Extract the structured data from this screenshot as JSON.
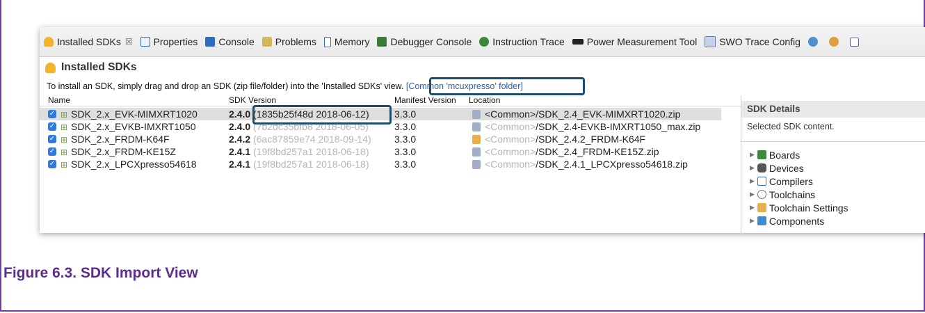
{
  "tabs": [
    {
      "label": "Installed SDKs",
      "icon": "sdk-icon",
      "cls": "sdk",
      "close": "☒"
    },
    {
      "label": "Properties",
      "icon": "properties-icon",
      "cls": "props"
    },
    {
      "label": "Console",
      "icon": "console-icon",
      "cls": "console"
    },
    {
      "label": "Problems",
      "icon": "problems-icon",
      "cls": "problems"
    },
    {
      "label": "Memory",
      "icon": "memory-icon",
      "cls": "memory"
    },
    {
      "label": "Debugger Console",
      "icon": "debugger-console-icon",
      "cls": "dbg"
    },
    {
      "label": "Instruction Trace",
      "icon": "instruction-trace-icon",
      "cls": "trace"
    },
    {
      "label": "Power Measurement Tool",
      "icon": "power-measurement-icon",
      "cls": "power"
    },
    {
      "label": "SWO Trace Config",
      "icon": "swo-trace-icon",
      "cls": "swo"
    }
  ],
  "view_title": "Installed SDKs",
  "instructions": {
    "text": "To install an SDK, simply drag and drop an SDK (zip file/folder) into the 'Installed SDKs' view.",
    "link": "[Common 'mcuxpresso' folder]"
  },
  "columns": {
    "name": "Name",
    "sdk_version": "SDK Version",
    "manifest_version": "Manifest Version",
    "location": "Location"
  },
  "rows": [
    {
      "name": "SDK_2.x_EVK-MIMXRT1020",
      "version": "2.4.0",
      "hash": "(1835b25f48d 2018-06-12)",
      "manifest": "3.3.0",
      "loc_prefix": "<Common>",
      "loc_file": "/SDK_2.4_EVK-MIMXRT1020.zip",
      "loc_icon": "zip-icon",
      "selected": true
    },
    {
      "name": "SDK_2.x_EVKB-IMXRT1050",
      "version": "2.4.0",
      "hash": "(7b2dc35bfb8 2018-06-05)",
      "manifest": "3.3.0",
      "loc_prefix": "<Common>",
      "loc_file": "/SDK_2.4-EVKB-IMXRT1050_max.zip",
      "loc_icon": "zip-icon",
      "selected": false
    },
    {
      "name": "SDK_2.x_FRDM-K64F",
      "version": "2.4.2",
      "hash": "(6ac87859e74 2018-09-14)",
      "manifest": "3.3.0",
      "loc_prefix": "<Common>",
      "loc_file": "/SDK_2.4.2_FRDM-K64F",
      "loc_icon": "folder-icon",
      "selected": false
    },
    {
      "name": "SDK_2.x_FRDM-KE15Z",
      "version": "2.4.1",
      "hash": "(19f8bd257a1 2018-06-18)",
      "manifest": "3.3.0",
      "loc_prefix": "<Common>",
      "loc_file": "/SDK_2.4_FRDM-KE15Z.zip",
      "loc_icon": "zip-icon",
      "selected": false
    },
    {
      "name": "SDK_2.x_LPCXpresso54618",
      "version": "2.4.1",
      "hash": "(19f8bd257a1 2018-06-18)",
      "manifest": "3.3.0",
      "loc_prefix": "<Common>",
      "loc_file": "/SDK_2.4.1_LPCXpresso54618.zip",
      "loc_icon": "zip-icon",
      "selected": false
    }
  ],
  "details": {
    "title": "SDK Details",
    "subtitle": "Selected SDK content.",
    "items": [
      {
        "label": "Boards",
        "icon": "boards-icon",
        "cls": "boards"
      },
      {
        "label": "Devices",
        "icon": "devices-icon",
        "cls": "devices"
      },
      {
        "label": "Compilers",
        "icon": "compilers-icon",
        "cls": "compilers"
      },
      {
        "label": "Toolchains",
        "icon": "toolchains-icon",
        "cls": "toolchains"
      },
      {
        "label": "Toolchain Settings",
        "icon": "toolchain-settings-icon",
        "cls": "settings"
      },
      {
        "label": "Components",
        "icon": "components-icon",
        "cls": "components"
      }
    ]
  },
  "caption": "Figure 6.3. SDK Import View",
  "colors": {
    "highlight": "#1d4e6e",
    "caption": "#5b2d8e",
    "link": "#2a5db0"
  }
}
